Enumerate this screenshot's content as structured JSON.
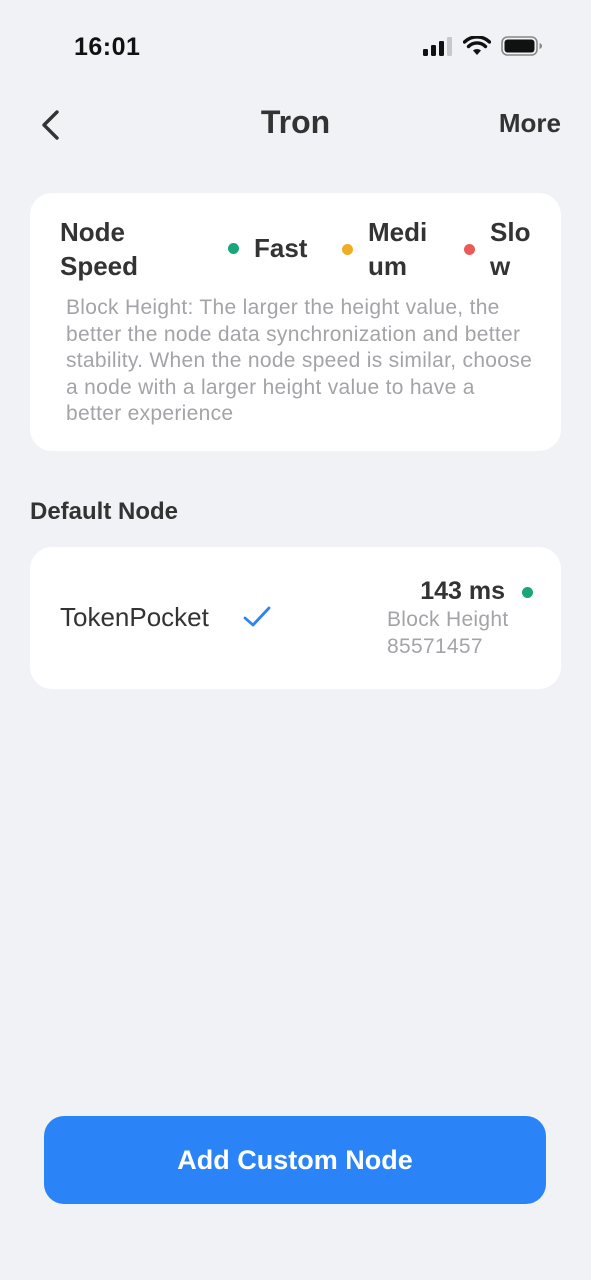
{
  "status_bar": {
    "time": "16:01",
    "icons": [
      "signal-icon",
      "wifi-icon",
      "battery-icon"
    ]
  },
  "nav": {
    "title": "Tron",
    "more_label": "More",
    "back_icon": "chevron-left-icon"
  },
  "legend": {
    "label": "Node Speed",
    "speeds": [
      {
        "label": "Fast",
        "color": "#1aa57a"
      },
      {
        "label": "Medium",
        "color": "#f0ad20"
      },
      {
        "label": "Slow",
        "color": "#eb5a56"
      }
    ],
    "description": "Block Height: The larger the height value, the better the node data synchronization and better stability. When the node speed is similar, choose a node with a larger height value to have a better experience"
  },
  "default_section": {
    "title": "Default Node"
  },
  "nodes": [
    {
      "name": "TokenPocket",
      "selected": true,
      "latency": "143 ms",
      "speed_color": "#1aa57a",
      "block_height_label": "Block Height",
      "block_height": "85571457"
    }
  ],
  "add_button": {
    "label": "Add Custom Node",
    "color": "#2b84f7"
  },
  "colors": {
    "background": "#f1f2f6",
    "check": "#2b84f7"
  }
}
